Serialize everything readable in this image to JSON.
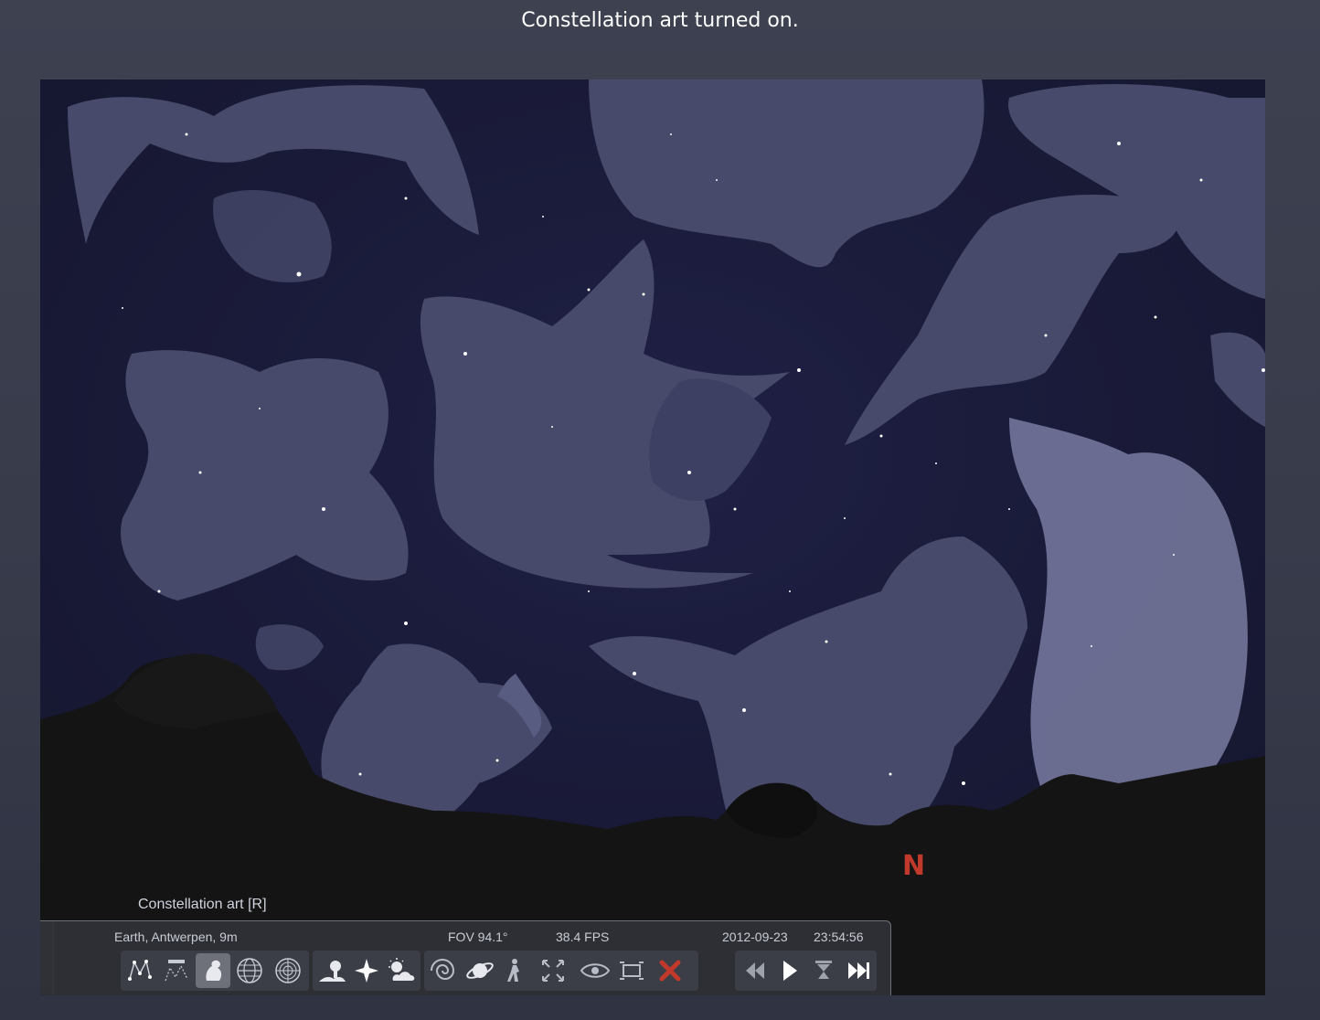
{
  "caption": "Constellation art turned on.",
  "compass": {
    "label": "N",
    "color": "#c0392b"
  },
  "tooltip": "Constellation art  [R]",
  "status": {
    "location": "Earth, Antwerpen, 9m",
    "fov": "FOV 94.1°",
    "fps": "38.4 FPS",
    "date": "2012-09-23",
    "time": "23:54:56"
  },
  "toolbar": {
    "buttons": [
      {
        "name": "constellation-lines-button",
        "icon": "constellation-lines-icon"
      },
      {
        "name": "constellation-labels-button",
        "icon": "constellation-labels-icon"
      },
      {
        "name": "constellation-art-button",
        "icon": "constellation-art-icon",
        "active": true
      },
      {
        "name": "equatorial-grid-button",
        "icon": "equatorial-grid-icon"
      },
      {
        "name": "azimuthal-grid-button",
        "icon": "azimuthal-grid-icon"
      },
      {
        "name": "ground-button",
        "icon": "ground-icon"
      },
      {
        "name": "cardinal-points-button",
        "icon": "cardinal-points-icon"
      },
      {
        "name": "atmosphere-button",
        "icon": "atmosphere-icon"
      },
      {
        "name": "nebulas-button",
        "icon": "nebula-icon"
      },
      {
        "name": "planet-labels-button",
        "icon": "planet-icon"
      },
      {
        "name": "equatorial-mount-button",
        "icon": "telescope-mount-icon"
      },
      {
        "name": "center-selected-button",
        "icon": "center-icon"
      },
      {
        "name": "night-mode-button",
        "icon": "eye-icon"
      },
      {
        "name": "full-screen-button",
        "icon": "fullscreen-icon"
      },
      {
        "name": "quit-button",
        "icon": "close-icon"
      },
      {
        "name": "decrease-time-speed-button",
        "icon": "rewind-icon"
      },
      {
        "name": "real-time-speed-button",
        "icon": "play-icon"
      },
      {
        "name": "current-time-button",
        "icon": "hourglass-icon"
      },
      {
        "name": "increase-time-speed-button",
        "icon": "fast-forward-icon"
      }
    ],
    "accent_close": "#c0392b"
  }
}
